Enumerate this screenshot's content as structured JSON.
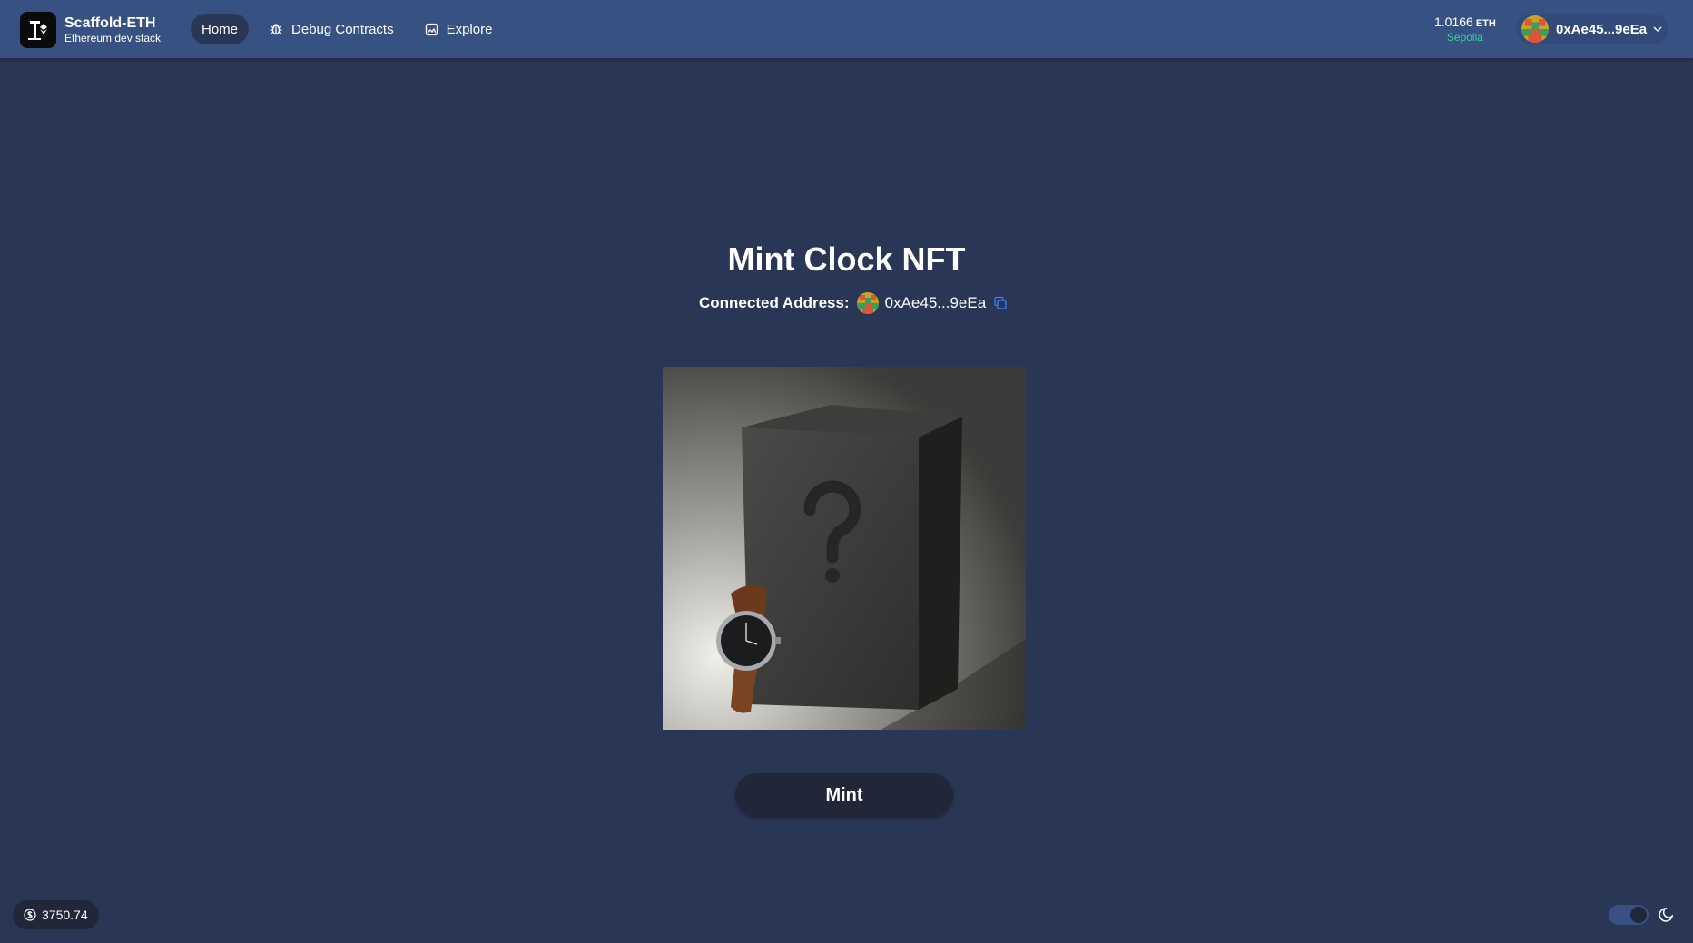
{
  "brand": {
    "title": "Scaffold-ETH",
    "subtitle": "Ethereum dev stack"
  },
  "nav": {
    "items": [
      {
        "label": "Home",
        "active": true,
        "icon": ""
      },
      {
        "label": "Debug Contracts",
        "active": false,
        "icon": "bug-icon"
      },
      {
        "label": "Explore",
        "active": false,
        "icon": "image-icon"
      }
    ]
  },
  "wallet": {
    "balance": "1.0166",
    "unit": "ETH",
    "network": "Sepolia",
    "address": "0xAe45...9eEa"
  },
  "main": {
    "title": "Mint Clock NFT",
    "connected_label": "Connected Address:",
    "connected_address": "0xAe45...9eEa",
    "mint_label": "Mint"
  },
  "footer": {
    "eth_price": "3750.74",
    "theme": "dark"
  },
  "colors": {
    "background": "#2a3655",
    "header": "#385183",
    "button": "#212638",
    "network": "#34d399"
  }
}
